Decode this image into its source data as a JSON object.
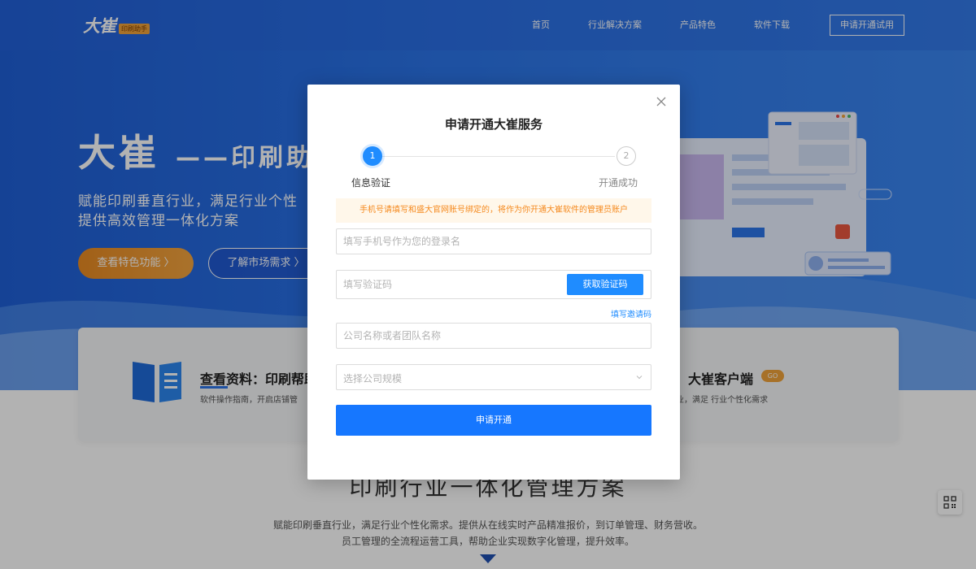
{
  "nav": {
    "logo": "大崔",
    "logo_tag": "印刷助手",
    "links": [
      "首页",
      "行业解决方案",
      "产品特色",
      "软件下载"
    ],
    "trial_button": "申请开通试用"
  },
  "hero": {
    "title_big": "大崔",
    "title_sub": "——印刷助",
    "desc_line1": "赋能印刷垂直行业，满足行业个性",
    "desc_line2": "提供高效管理一体化方案",
    "btn_features": "查看特色功能 〉",
    "btn_market": "了解市场需求 〉"
  },
  "cards": {
    "left_title": "查看资料：印刷帮助",
    "left_desc": "软件操作指南，开启店铺管",
    "right_title": "大崔客户端",
    "right_badge": "GO",
    "right_desc": "业，满足 行业个性化需求"
  },
  "section": {
    "title": "印刷行业一体化管理方案",
    "desc_line1": "赋能印刷垂直行业，满足行业个性化需求。提供从在线实时产品精准报价，到订单管理、财务营收。",
    "desc_line2": "员工管理的全流程运营工具，帮助企业实现数字化管理，提升效率。"
  },
  "modal": {
    "title": "申请开通大崔服务",
    "steps": [
      {
        "number": "1",
        "label": "信息验证"
      },
      {
        "number": "2",
        "label": "开通成功"
      }
    ],
    "notice": "手机号请填写和盛大官网账号绑定的，将作为你开通大崔软件的管理员账户",
    "phone_placeholder": "填写手机号作为您的登录名",
    "code_placeholder": "填写验证码",
    "code_button": "获取验证码",
    "invite_link": "填写邀请码",
    "company_placeholder": "公司名称或者团队名称",
    "scale_placeholder": "选择公司规模",
    "submit_button": "申请开通"
  },
  "colors": {
    "primary": "#1677ff",
    "hero_blue": "#2b74e8",
    "orange": "#f0a33a",
    "notice_text": "#f58a1f"
  },
  "icons": [
    "close-icon",
    "chevron-down-icon",
    "book-icon",
    "qr-code-icon",
    "arrow-down-icon"
  ]
}
